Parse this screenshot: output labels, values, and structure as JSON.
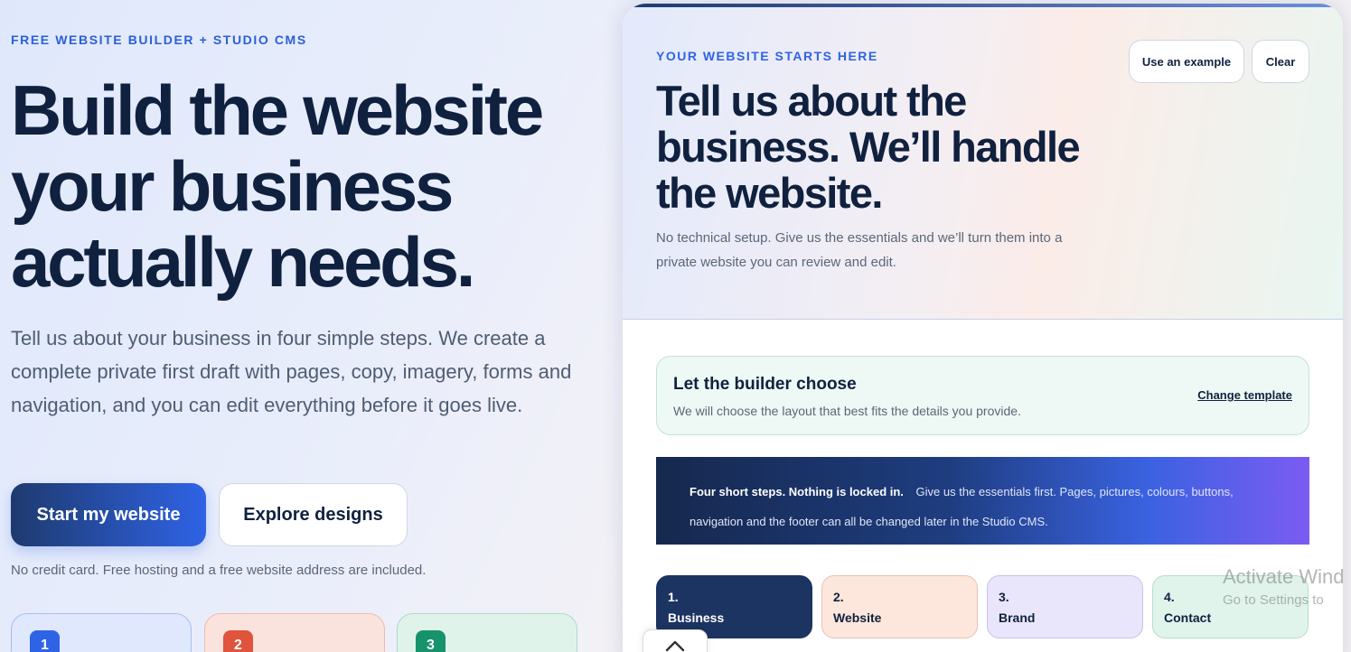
{
  "hero": {
    "eyebrow": "FREE WEBSITE BUILDER + STUDIO CMS",
    "title": "Build the website your business actually needs.",
    "description": "Tell us about your business in four simple steps. We create a complete private first draft with pages, copy, imagery, forms and navigation, and you can edit everything before it goes live.",
    "primary_button": "Start my website",
    "secondary_button": "Explore designs",
    "note": "No credit card. Free hosting and a free website address are included.",
    "step_cards": [
      "1",
      "2",
      "3"
    ]
  },
  "panel": {
    "eyebrow": "YOUR WEBSITE STARTS HERE",
    "title": "Tell us about the business. We’ll handle the website.",
    "description": "No technical setup. Give us the essentials and we’ll turn them into a private website you can review and edit.",
    "use_example": "Use an example",
    "clear": "Clear",
    "template": {
      "title": "Let the builder choose",
      "subtitle": "We will choose the layout that best fits the details you provide.",
      "link": "Change template"
    },
    "banner": {
      "strong": "Four short steps. Nothing is locked in.",
      "text": "Give us the essentials first. Pages, pictures, colours, buttons, navigation and the footer can all be changed later in the Studio CMS."
    },
    "steps": [
      {
        "num": "1.",
        "label": "Business"
      },
      {
        "num": "2.",
        "label": "Website"
      },
      {
        "num": "3.",
        "label": "Brand"
      },
      {
        "num": "4.",
        "label": "Contact"
      }
    ]
  },
  "watermark": {
    "line1": "Activate Wind",
    "line2": "Go to Settings to"
  }
}
